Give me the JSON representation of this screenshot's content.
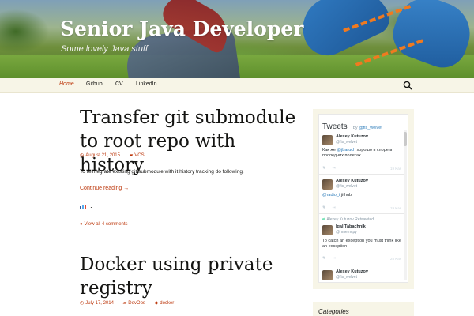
{
  "site": {
    "title": "Senior Java Developer",
    "description": "Some lovely Java stuff"
  },
  "nav": {
    "items": [
      {
        "label": "Home",
        "active": true
      },
      {
        "label": "Github",
        "active": false
      },
      {
        "label": "CV",
        "active": false
      },
      {
        "label": "LinkedIn",
        "active": false
      }
    ],
    "search_icon": "search-icon"
  },
  "posts": [
    {
      "title": "Transfer git submodule to root repo with history",
      "date": "August 21, 2015",
      "category": "VCS",
      "excerpt": "To reintegrate existing git submodule with it history tracking do following.",
      "continue_label": "Continue reading →",
      "share_label": ":",
      "comments_label": "View all 4 comments"
    },
    {
      "title": "Docker using private registry",
      "date": "July 17, 2014",
      "category": "DevOps",
      "tag": "docker"
    }
  ],
  "sidebar": {
    "tweets_widget": {
      "title": "Tweets",
      "by_label": "by",
      "by_handle": "@fis_welvet",
      "tweets": [
        {
          "name": "Alexey Kutuzov",
          "handle": "@fis_welvet",
          "text_prefix": "Как же ",
          "mention": "@jbaruch",
          "text_suffix": " хорошо в споре в последних полетах",
          "date": "19 Kas"
        },
        {
          "name": "Alexey Kutuzov",
          "handle": "@fis_welvet",
          "mention": "@radio_t",
          "text_suffix": " jithub",
          "date": "19 Kas"
        },
        {
          "retweet_label": "Alexey Kutuzov Retweeted",
          "name": "Igal Tabachnik",
          "handle": "@hmemcpy",
          "text_suffix": "To catch an exception you must think like an exception",
          "date": "25 Kas"
        },
        {
          "name": "Alexey Kutuzov",
          "handle": "@fis_welvet",
          "text_suffix": "",
          "date": ""
        }
      ]
    },
    "categories_title": "Categories"
  },
  "colors": {
    "accent": "#bc360a",
    "navbar_bg": "#f7f5e7",
    "twitter_link": "#2b7bb9"
  }
}
